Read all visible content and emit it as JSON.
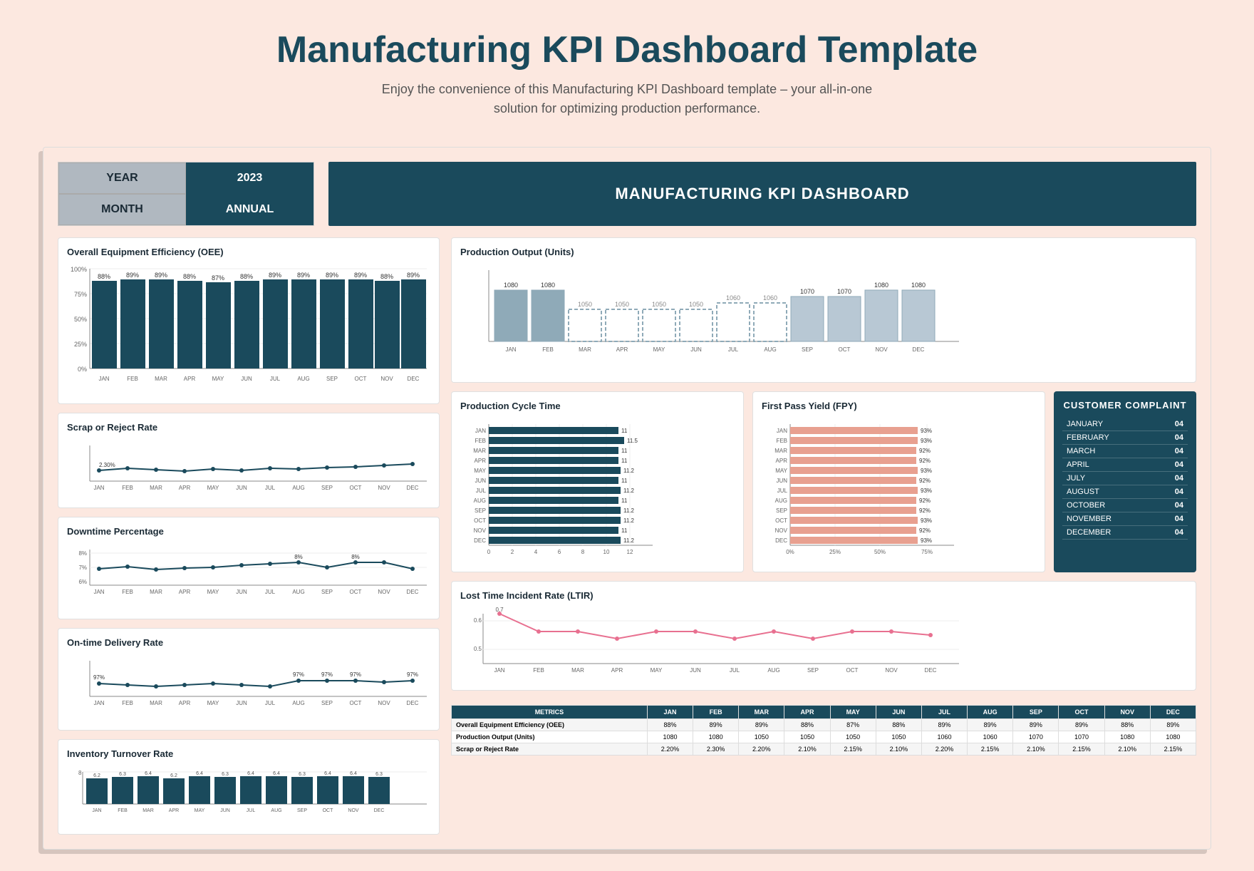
{
  "header": {
    "title": "Manufacturing KPI Dashboard Template",
    "subtitle": "Enjoy the convenience of this Manufacturing KPI Dashboard template – your all-in-one solution for optimizing production performance."
  },
  "year_label": "YEAR",
  "year_value": "2023",
  "month_label": "MONTH",
  "month_value": "ANNUAL",
  "kpi_dashboard_title": "MANUFACTURING KPI DASHBOARD",
  "oee": {
    "title": "Overall Equipment Efficiency (OEE)",
    "months": [
      "JAN",
      "FEB",
      "MAR",
      "APR",
      "MAY",
      "JUN",
      "JUL",
      "AUG",
      "SEP",
      "OCT",
      "NOV",
      "DEC"
    ],
    "values": [
      88,
      89,
      89,
      88,
      87,
      88,
      89,
      89,
      89,
      89,
      88,
      89
    ],
    "y_labels": [
      "100%",
      "75%",
      "50%",
      "25%",
      "0%"
    ]
  },
  "production_output": {
    "title": "Production Output (Units)",
    "months": [
      "JAN",
      "FEB",
      "MAR",
      "APR",
      "MAY",
      "JUN",
      "JUL",
      "AUG",
      "SEP",
      "OCT",
      "NOV",
      "DEC"
    ],
    "values": [
      1080,
      1080,
      1050,
      1050,
      1050,
      1050,
      1060,
      1060,
      1070,
      1070,
      1080,
      1080
    ]
  },
  "scrap": {
    "title": "Scrap or Reject Rate",
    "months": [
      "JAN",
      "FEB",
      "MAR",
      "APR",
      "MAY",
      "JUN",
      "JUL",
      "AUG",
      "SEP",
      "OCT",
      "NOV",
      "DEC"
    ],
    "start_label": "2.30%"
  },
  "downtime": {
    "title": "Downtime Percentage",
    "months": [
      "JAN",
      "FEB",
      "MAR",
      "APR",
      "MAY",
      "JUN",
      "JUL",
      "AUG",
      "SEP",
      "OCT",
      "NOV",
      "DEC"
    ],
    "y_labels": [
      "8%",
      "7%",
      "6%"
    ],
    "peak_labels": [
      "8%",
      "8%"
    ]
  },
  "delivery": {
    "title": "On-time Delivery Rate",
    "months": [
      "JAN",
      "FEB",
      "MAR",
      "APR",
      "MAY",
      "JUN",
      "JUL",
      "AUG",
      "SEP",
      "OCT",
      "NOV",
      "DEC"
    ],
    "values": [
      "97%",
      "",
      "",
      "",
      "",
      "",
      "",
      "97%",
      "97%",
      "97%",
      "",
      "97%"
    ]
  },
  "cycle_time": {
    "title": "Production Cycle Time",
    "months": [
      "JAN",
      "FEB",
      "MAR",
      "APR",
      "MAY",
      "JUN",
      "JUL",
      "AUG",
      "SEP",
      "OCT",
      "NOV"
    ],
    "values": [
      11,
      11.5,
      11,
      11,
      11.2,
      11,
      11.2,
      11,
      11.2,
      11.2,
      11,
      11.2
    ],
    "x_labels": [
      "0",
      "2",
      "4",
      "6",
      "8",
      "10",
      "12"
    ]
  },
  "fpy": {
    "title": "First Pass Yield (FPY)",
    "months": [
      "JAN",
      "FEB",
      "MAR",
      "APR",
      "MAY",
      "JUN",
      "JUL",
      "AUG",
      "SEP",
      "OCT",
      "NOV"
    ],
    "values": [
      93,
      93,
      92,
      92,
      93,
      92,
      93,
      92,
      92,
      93,
      92,
      93
    ],
    "x_labels": [
      "0%",
      "25%",
      "50%",
      "75%"
    ]
  },
  "customer_complaint": {
    "title": "CUSTOMER COMPLAINT",
    "rows": [
      {
        "month": "JANUARY",
        "value": "04"
      },
      {
        "month": "FEBRUARY",
        "value": "04"
      },
      {
        "month": "MARCH",
        "value": "04"
      },
      {
        "month": "APRIL",
        "value": "04"
      },
      {
        "month": "JULY",
        "value": "04"
      },
      {
        "month": "AUGUST",
        "value": "04"
      },
      {
        "month": "OCTOBER",
        "value": "04"
      },
      {
        "month": "NOVEMBER",
        "value": "04"
      },
      {
        "month": "DECEMBER",
        "value": "04"
      }
    ]
  },
  "ltir": {
    "title": "Lost Time Incident Rate (LTIR)",
    "y_labels": [
      "0.6",
      "0.5"
    ],
    "peak": "0.7",
    "months": [
      "JAN",
      "FEB",
      "MAR",
      "APR",
      "MAY",
      "JUN",
      "JUL",
      "AUG",
      "SEP",
      "OCT",
      "NOV",
      "DEC"
    ]
  },
  "inventory": {
    "title": "Inventory Turnover Rate",
    "months": [
      "JAN",
      "FEB",
      "MAR",
      "APR",
      "MAY",
      "JUN",
      "JUL",
      "AUG",
      "SEP",
      "OCT",
      "NOV",
      "DEC"
    ],
    "values": [
      "6.2",
      "6.3",
      "6.4",
      "6.2",
      "6.4",
      "6.3",
      "6.4",
      "6.4",
      "6.3",
      "6.4",
      "6.4",
      "6.3"
    ],
    "y_label": "8"
  },
  "summary_table": {
    "headers": [
      "METRICS",
      "JAN",
      "FEB",
      "MAR",
      "APR",
      "MAY",
      "JUN",
      "JUL",
      "AUG",
      "SEP",
      "OCT",
      "NOV",
      "DEC"
    ],
    "rows": [
      {
        "label": "Overall Equipment Efficiency (OEE)",
        "values": [
          "88%",
          "89%",
          "89%",
          "88%",
          "87%",
          "88%",
          "89%",
          "89%",
          "89%",
          "89%",
          "88%",
          "89%"
        ]
      },
      {
        "label": "Production Output (Units)",
        "values": [
          "1080",
          "1080",
          "1050",
          "1050",
          "1050",
          "1050",
          "1060",
          "1060",
          "1070",
          "1070",
          "1080",
          "1080"
        ]
      },
      {
        "label": "Scrap or Reject Rate",
        "values": [
          "2.20%",
          "2.30%",
          "2.20%",
          "2.10%",
          "2.15%",
          "2.10%",
          "2.20%",
          "2.15%",
          "2.10%",
          "2.15%",
          "2.10%",
          "2.15%"
        ]
      }
    ]
  }
}
